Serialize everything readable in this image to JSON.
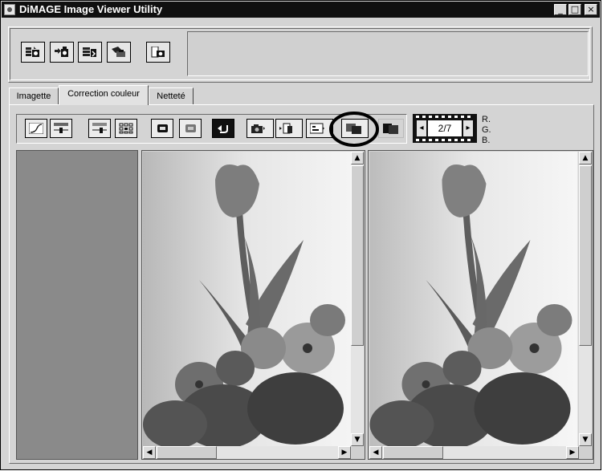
{
  "window": {
    "title": "DiMAGE Image Viewer Utility"
  },
  "caption_buttons": {
    "minimize": "_",
    "maximize": "□",
    "close": "×"
  },
  "toolbar": {
    "buttons": [
      {
        "name": "import-image-button",
        "icon": "camera-import-icon"
      },
      {
        "name": "export-image-button",
        "icon": "camera-export-icon"
      },
      {
        "name": "save-image-button",
        "icon": "save-stack-icon"
      },
      {
        "name": "print-image-button",
        "icon": "print-icon"
      },
      {
        "name": "camera-settings-button",
        "icon": "camera-icon"
      }
    ]
  },
  "tabs": [
    {
      "label": "Imagette",
      "active": false
    },
    {
      "label": "Correction couleur",
      "active": true
    },
    {
      "label": "Netteté",
      "active": false
    }
  ],
  "correction_toolbar": {
    "buttons": [
      {
        "name": "tone-curve-button",
        "icon": "curve-icon"
      },
      {
        "name": "brightness-contrast-button",
        "icon": "slider-icon"
      },
      {
        "name": "hue-saturation-button",
        "icon": "slider-alt-icon"
      },
      {
        "name": "variation-button",
        "icon": "grid-icon"
      },
      {
        "name": "undo-button",
        "icon": "undo-icon"
      },
      {
        "name": "redo-button",
        "icon": "redo-icon"
      },
      {
        "name": "reset-button",
        "icon": "reset-icon"
      },
      {
        "name": "snapshot-button",
        "icon": "camera-snapshot-icon"
      },
      {
        "name": "apply-button",
        "icon": "apply-icon"
      },
      {
        "name": "compare-button",
        "icon": "compare-icon"
      },
      {
        "name": "before-after-button",
        "icon": "before-after-icon"
      },
      {
        "name": "single-view-button",
        "icon": "single-view-icon"
      }
    ]
  },
  "frame_counter": {
    "value": "2/7",
    "prev": "◂",
    "next": "▸"
  },
  "rgb_labels": [
    "R.",
    "G.",
    "B."
  ],
  "scrollbar_glyphs": {
    "up": "▲",
    "down": "▼",
    "left": "◀",
    "right": "▶"
  },
  "colors": {
    "titlebar": "#101010",
    "dialog": "#d4d4d4",
    "side_panel": "#8a8a8a",
    "highlight_ring": "#000000"
  }
}
